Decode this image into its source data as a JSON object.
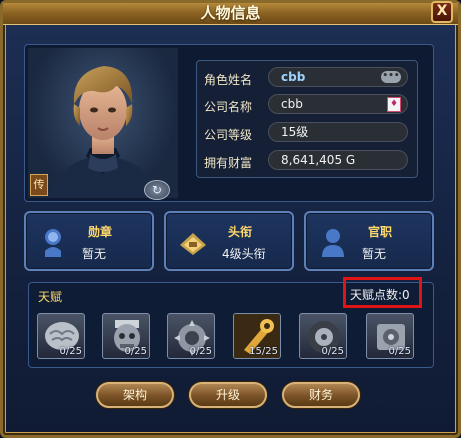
{
  "window": {
    "title": "人物信息",
    "close_label": "X"
  },
  "portrait": {
    "badge_label": "传",
    "rotate_label": "↻"
  },
  "info": {
    "rows": [
      {
        "label": "角色姓名",
        "value": "cbb"
      },
      {
        "label": "公司名称",
        "value": "cbb"
      },
      {
        "label": "公司等级",
        "value": "15级"
      },
      {
        "label": "拥有财富",
        "value": "8,641,405 G"
      }
    ]
  },
  "cards": [
    {
      "title": "勋章",
      "value": "暂无",
      "icon": "medal-icon"
    },
    {
      "title": "头衔",
      "value": "4级头衔",
      "icon": "title-icon"
    },
    {
      "title": "官职",
      "value": "暂无",
      "icon": "official-icon"
    }
  ],
  "talent": {
    "label": "天赋",
    "points_text": "天赋点数:0",
    "slots": [
      {
        "icon": "brain-icon",
        "count": "0/25"
      },
      {
        "icon": "mask-icon",
        "count": "0/25"
      },
      {
        "icon": "gear-helmet-icon",
        "count": "0/25"
      },
      {
        "icon": "wrench-icon",
        "count": "15/25"
      },
      {
        "icon": "tire-icon",
        "count": "0/25"
      },
      {
        "icon": "gear-box-icon",
        "count": "0/25"
      }
    ]
  },
  "buttons": {
    "structure": "架构",
    "upgrade": "升级",
    "finance": "财务"
  },
  "colors": {
    "accent_gold": "#ffd96a",
    "frame_gold": "#c9a24b",
    "highlight_red": "#e01414"
  }
}
